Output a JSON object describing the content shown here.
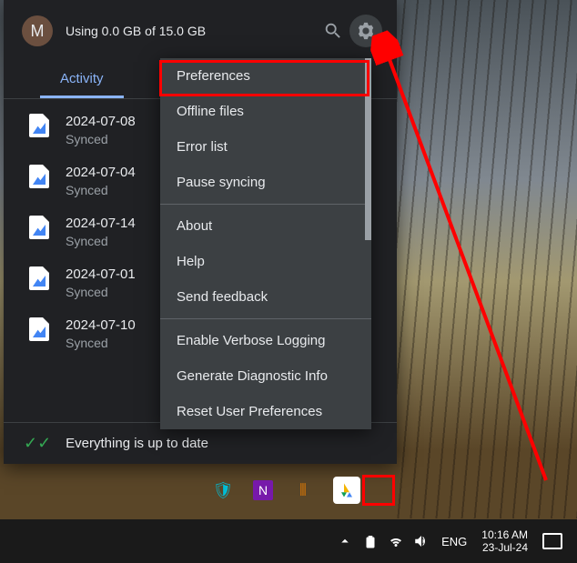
{
  "header": {
    "avatar_initial": "M",
    "storage_text": "Using 0.0 GB of 15.0 GB"
  },
  "tabs": {
    "activity": "Activity"
  },
  "files": [
    {
      "name": "2024-07-08",
      "status": "Synced"
    },
    {
      "name": "2024-07-04",
      "status": "Synced"
    },
    {
      "name": "2024-07-14",
      "status": "Synced"
    },
    {
      "name": "2024-07-01",
      "status": "Synced"
    },
    {
      "name": "2024-07-10",
      "status": "Synced"
    }
  ],
  "footer": {
    "status": "Everything is up to date"
  },
  "menu": {
    "preferences": "Preferences",
    "offline_files": "Offline files",
    "error_list": "Error list",
    "pause_syncing": "Pause syncing",
    "about": "About",
    "help": "Help",
    "send_feedback": "Send feedback",
    "enable_verbose": "Enable Verbose Logging",
    "gen_diag": "Generate Diagnostic Info",
    "reset_prefs": "Reset User Preferences"
  },
  "taskbar": {
    "lang": "ENG",
    "time": "10:16 AM",
    "date": "23-Jul-24"
  }
}
